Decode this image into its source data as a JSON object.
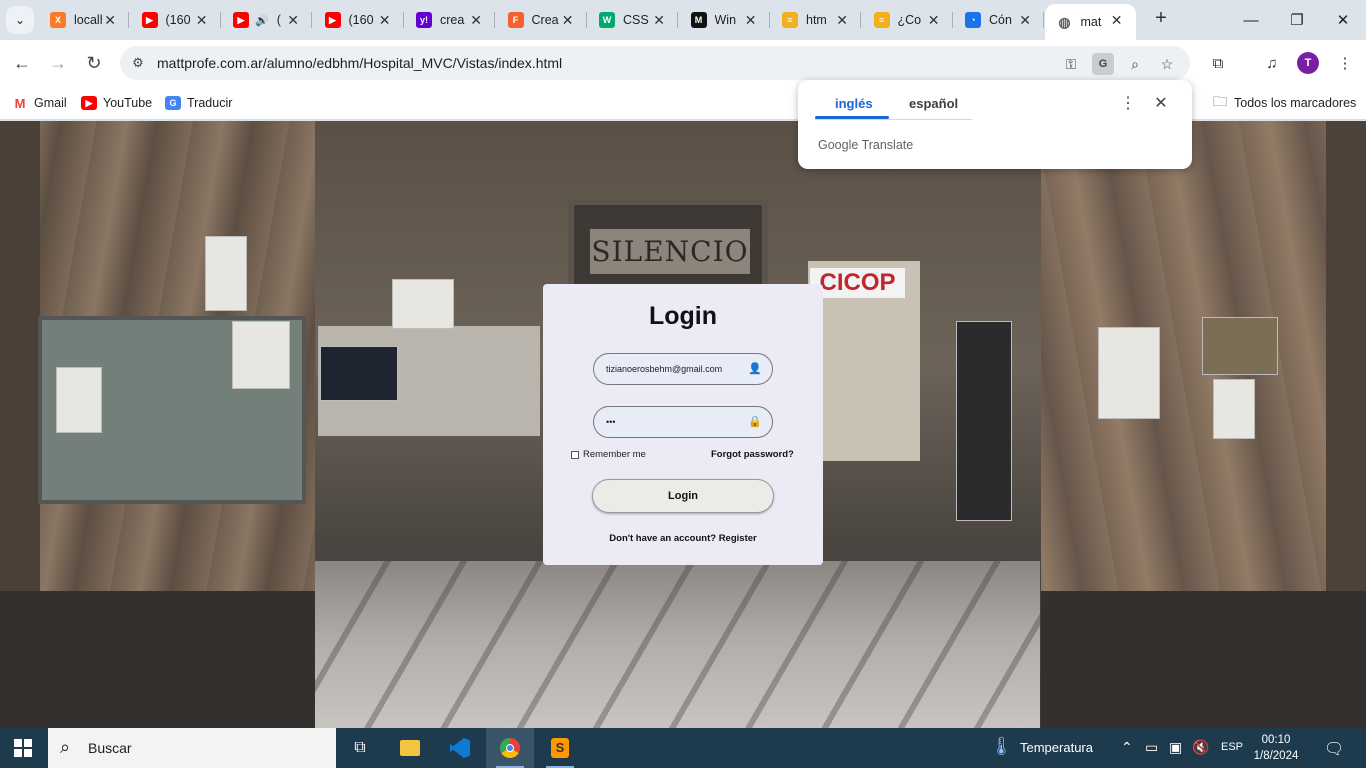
{
  "browser": {
    "tabs": [
      {
        "title": "localhost",
        "favicon": "xampp-icon",
        "color": "#fb7a24",
        "active": false
      },
      {
        "title": "(160",
        "favicon": "youtube-icon",
        "color": "#ff0000",
        "active": false
      },
      {
        "title": "(",
        "favicon": "youtube-icon",
        "color": "#ff0000",
        "active": false,
        "audio": true
      },
      {
        "title": "(160",
        "favicon": "youtube-icon",
        "color": "#ff0000",
        "active": false
      },
      {
        "title": "crea",
        "favicon": "yahoo-icon",
        "color": "#6001d2",
        "active": false
      },
      {
        "title": "Crea",
        "favicon": "flaticon-icon",
        "color": "#f4612b",
        "active": false
      },
      {
        "title": "CSS",
        "favicon": "w3schools-icon",
        "color": "#04aa6d",
        "active": false
      },
      {
        "title": "Win",
        "favicon": "medium-icon",
        "color": "#111111",
        "active": false
      },
      {
        "title": "htm",
        "favicon": "stackoverflow-icon",
        "color": "#f2b01e",
        "active": false
      },
      {
        "title": "¿Co",
        "favicon": "stackoverflow-icon",
        "color": "#f2b01e",
        "active": false
      },
      {
        "title": "Cón",
        "favicon": "blue-loop-icon",
        "color": "#1a73e8",
        "active": false
      },
      {
        "title": "mat",
        "favicon": "globe-icon",
        "color": "#5f6368",
        "active": true
      }
    ],
    "url": "mattprofe.com.ar/alumno/edbhm/Hospital_MVC/Vistas/index.html",
    "profile_initial": "T",
    "bookmarks": [
      {
        "label": "Gmail",
        "icon": "gmail-icon"
      },
      {
        "label": "YouTube",
        "icon": "youtube-icon"
      },
      {
        "label": "Traducir",
        "icon": "google-translate-icon"
      }
    ],
    "all_bookmarks": "Todos los marcadores"
  },
  "translate_popup": {
    "tabs": [
      "inglés",
      "español"
    ],
    "active_tab": "inglés",
    "brand_google": "Google",
    "brand_translate": "Translate"
  },
  "login": {
    "title": "Login",
    "email_value": "tizianoerosbehm@gmail.com",
    "password_value": "•••",
    "remember_label": "Remember me",
    "forgot_label": "Forgot password?",
    "button_label": "Login",
    "register_label": "Don't have an account? Register"
  },
  "background": {
    "sign_text": "SILENCIO",
    "union_sign": "CICOP"
  },
  "taskbar": {
    "search_placeholder": "Buscar",
    "weather_label": "Temperatura",
    "language": "ESP",
    "time": "00:10",
    "date": "1/8/2024"
  }
}
